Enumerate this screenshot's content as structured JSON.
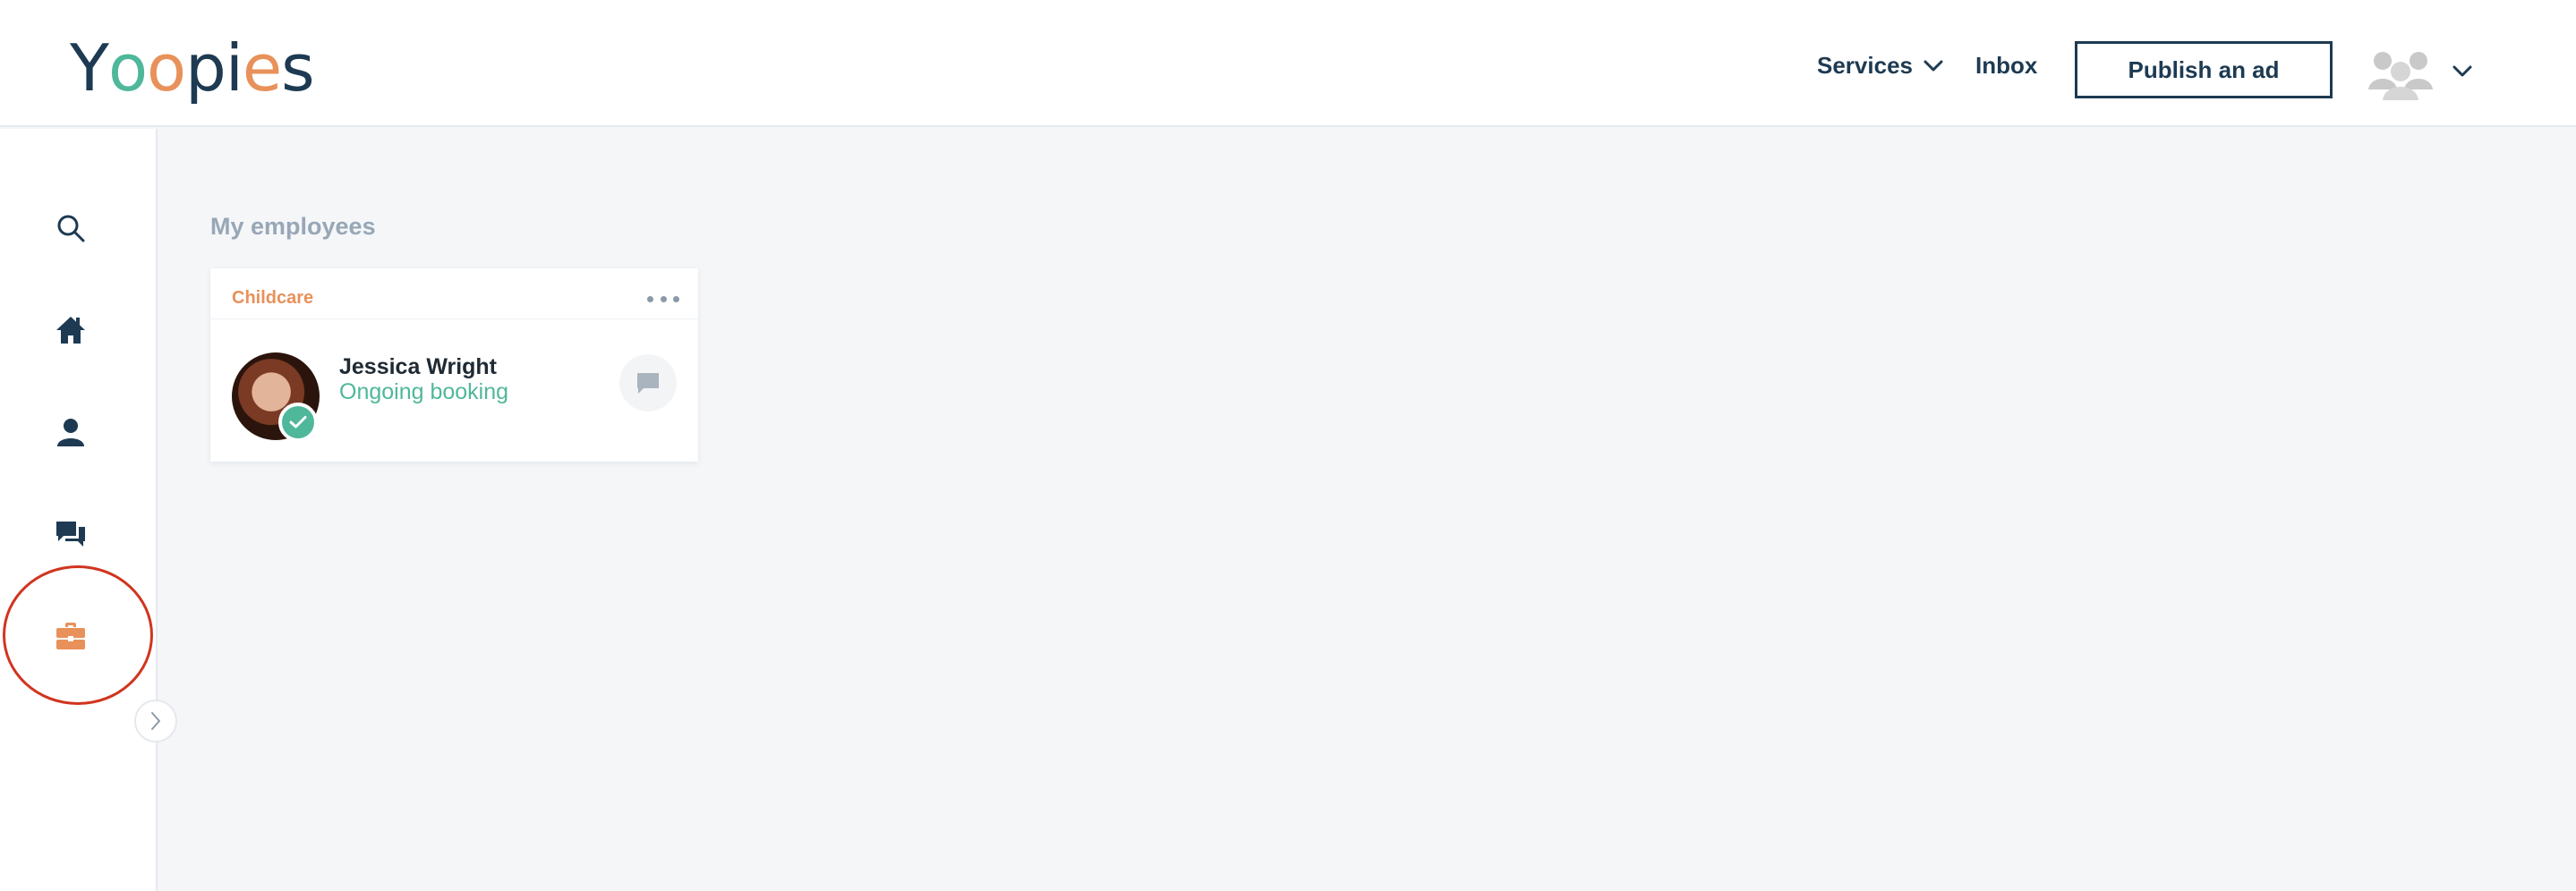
{
  "brand": {
    "logo_letters": [
      "Y",
      "o",
      "o",
      "p",
      "i",
      "e",
      "s"
    ],
    "logo_colors": [
      "#1d3a52",
      "#4fb79a",
      "#e8915a",
      "#1d3a52",
      "#1d3a52",
      "#e8915a",
      "#1d3a52"
    ]
  },
  "header": {
    "services_label": "Services",
    "inbox_label": "Inbox",
    "publish_label": "Publish an ad",
    "avatar_icon": "user-group-icon",
    "menu_icon": "chevron-down-icon"
  },
  "sidebar": {
    "items": [
      {
        "icon": "search-icon",
        "active": false
      },
      {
        "icon": "home-icon",
        "active": false
      },
      {
        "icon": "user-icon",
        "active": false
      },
      {
        "icon": "chat-icon",
        "active": false
      },
      {
        "icon": "briefcase-icon",
        "active": true
      }
    ],
    "toggle_icon": "chevron-right-icon"
  },
  "main": {
    "section_title": "My employees",
    "employees": [
      {
        "category": "Childcare",
        "name": "Jessica Wright",
        "status": "Ongoing booking",
        "verified": true
      }
    ]
  },
  "colors": {
    "navy": "#1d3a52",
    "accent_orange": "#e8915a",
    "accent_green": "#4fb79a",
    "highlight_red": "#d0351f",
    "muted": "#97a7b6"
  }
}
